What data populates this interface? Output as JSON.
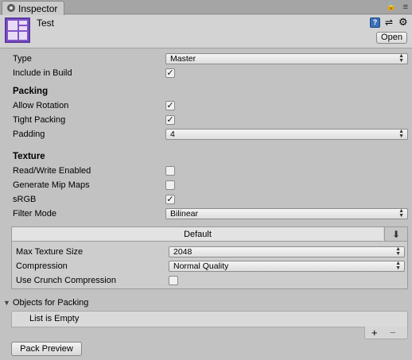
{
  "tab": {
    "label": "Inspector"
  },
  "header": {
    "title": "Test",
    "open_label": "Open"
  },
  "fields": {
    "type": {
      "label": "Type",
      "value": "Master"
    },
    "include_in_build": {
      "label": "Include in Build",
      "checked": true
    }
  },
  "packing": {
    "heading": "Packing",
    "allow_rotation": {
      "label": "Allow Rotation",
      "checked": true
    },
    "tight_packing": {
      "label": "Tight Packing",
      "checked": true
    },
    "padding": {
      "label": "Padding",
      "value": "4"
    }
  },
  "texture": {
    "heading": "Texture",
    "read_write": {
      "label": "Read/Write Enabled",
      "checked": false
    },
    "mip_maps": {
      "label": "Generate Mip Maps",
      "checked": false
    },
    "srgb": {
      "label": "sRGB",
      "checked": true
    },
    "filter_mode": {
      "label": "Filter Mode",
      "value": "Bilinear"
    }
  },
  "platform": {
    "tab_label": "Default",
    "max_texture_size": {
      "label": "Max Texture Size",
      "value": "2048"
    },
    "compression": {
      "label": "Compression",
      "value": "Normal Quality"
    },
    "crunch": {
      "label": "Use Crunch Compression",
      "checked": false
    }
  },
  "objects": {
    "heading": "Objects for Packing",
    "empty_text": "List is Empty",
    "add_symbol": "+",
    "remove_symbol": "−"
  },
  "pack_preview_label": "Pack Preview",
  "icons": {
    "check": "✓",
    "dropdown_arrows": "▲▼",
    "foldout": "▼",
    "download": "⬇",
    "help": "?",
    "gear": "⚙"
  },
  "colors": {
    "accent": "#7f54c8"
  }
}
